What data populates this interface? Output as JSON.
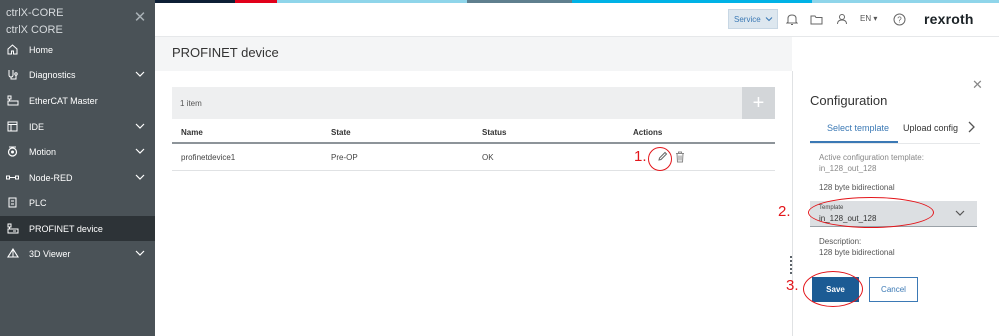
{
  "app": {
    "brand_line1": "ctrlX-CORE",
    "brand_line2": "ctrlX CORE",
    "logo": "rexroth"
  },
  "colors": {
    "accent": "#3b79b5",
    "save_button": "#1c5b94",
    "sidebar_bg": "#4a5257",
    "sidebar_active": "#2d3337",
    "annotation": "#e3161b",
    "strip": [
      "#0d1f35",
      "#e1001a",
      "#8fd5ea",
      "#5f7f8e",
      "#00b2e6",
      "#8fd5ea"
    ]
  },
  "sidebar": {
    "items": [
      {
        "label": "Home",
        "icon": "home-icon",
        "expandable": false
      },
      {
        "label": "Diagnostics",
        "icon": "diagnostics-icon",
        "expandable": true
      },
      {
        "label": "EtherCAT Master",
        "icon": "ethercat-icon",
        "expandable": false
      },
      {
        "label": "IDE",
        "icon": "ide-icon",
        "expandable": true
      },
      {
        "label": "Motion",
        "icon": "motion-icon",
        "expandable": true
      },
      {
        "label": "Node-RED",
        "icon": "node-red-icon",
        "expandable": true
      },
      {
        "label": "PLC",
        "icon": "plc-icon",
        "expandable": false
      },
      {
        "label": "PROFINET device",
        "icon": "profinet-icon",
        "expandable": false,
        "active": true
      },
      {
        "label": "3D Viewer",
        "icon": "viewer-3d-icon",
        "expandable": true
      }
    ]
  },
  "topbar": {
    "service_label": "Service",
    "language": "EN"
  },
  "page": {
    "title": "PROFINET device",
    "item_count": "1 item",
    "add_label": "+",
    "columns": [
      "Name",
      "State",
      "Status",
      "Actions"
    ],
    "rows": [
      {
        "name": "profinetdevice1",
        "state": "Pre-OP",
        "status": "OK"
      }
    ]
  },
  "annotations": {
    "step1": "1.",
    "step2": "2.",
    "step3": "3."
  },
  "panel": {
    "title": "Configuration",
    "tabs": [
      "Select template",
      "Upload config"
    ],
    "active_template_label": "Active configuration template:",
    "active_template_value": "in_128_out_128",
    "active_template_desc": "128 byte bidirectional",
    "template_field_label": "Template",
    "template_field_value": "in_128_out_128",
    "description_label": "Description:",
    "description_value": "128 byte bidirectional",
    "save_label": "Save",
    "cancel_label": "Cancel"
  }
}
